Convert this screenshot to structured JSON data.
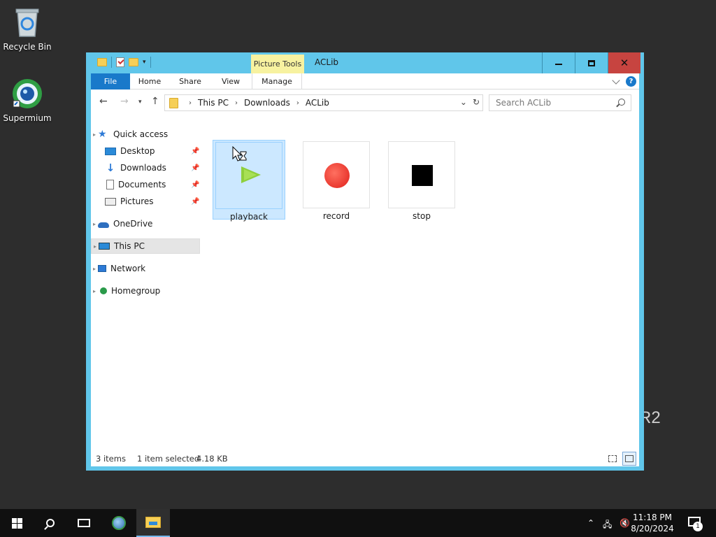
{
  "desktop": {
    "icons": [
      {
        "label": "Recycle Bin",
        "icon": "recycle-bin-icon"
      },
      {
        "label": "Supermium",
        "icon": "supermium-browser-icon"
      }
    ],
    "watermark": "R2"
  },
  "window": {
    "title": "ACLib",
    "context_tab": "Picture Tools",
    "ribbon_tabs": [
      "File",
      "Home",
      "Share",
      "View",
      "Manage"
    ],
    "address": {
      "crumbs": [
        "This PC",
        "Downloads",
        "ACLib"
      ]
    },
    "search": {
      "placeholder": "Search ACLib"
    },
    "nav": {
      "quick_access": "Quick access",
      "pinned": [
        "Desktop",
        "Downloads",
        "Documents",
        "Pictures"
      ],
      "onedrive": "OneDrive",
      "this_pc": "This PC",
      "network": "Network",
      "homegroup": "Homegroup"
    },
    "files": [
      {
        "name": "playback",
        "icon": "play-icon",
        "selected": true
      },
      {
        "name": "record",
        "icon": "record-icon",
        "selected": false
      },
      {
        "name": "stop",
        "icon": "stop-icon",
        "selected": false
      }
    ],
    "status": {
      "count": "3 items",
      "selection": "1 item selected",
      "size": "4.18 KB"
    }
  },
  "taskbar": {
    "time": "11:18 PM",
    "date": "8/20/2024",
    "notification_count": "1"
  }
}
